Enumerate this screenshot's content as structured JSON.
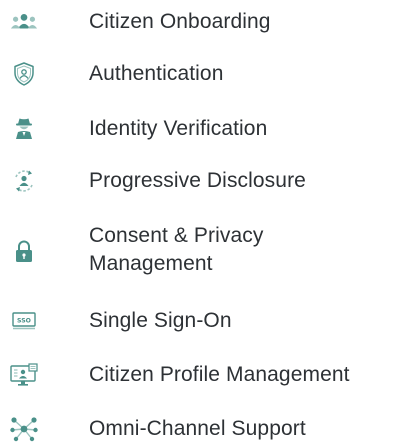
{
  "features": {
    "items": [
      {
        "label": "Citizen Onboarding",
        "icon": "people-group-icon"
      },
      {
        "label": "Authentication",
        "icon": "shield-user-icon"
      },
      {
        "label": "Identity Verification",
        "icon": "detective-icon"
      },
      {
        "label": "Progressive Disclosure",
        "icon": "user-refresh-icon"
      },
      {
        "label": "Consent & Privacy Management",
        "icon": "lock-icon"
      },
      {
        "label": "Single Sign-On",
        "icon": "sso-icon"
      },
      {
        "label": "Citizen Profile Management",
        "icon": "profile-monitor-icon"
      },
      {
        "label": "Omni-Channel Support",
        "icon": "network-hub-icon"
      }
    ]
  },
  "colors": {
    "icon_primary": "#4a9089",
    "icon_light": "#9cc4bf",
    "text": "#2d3135"
  }
}
